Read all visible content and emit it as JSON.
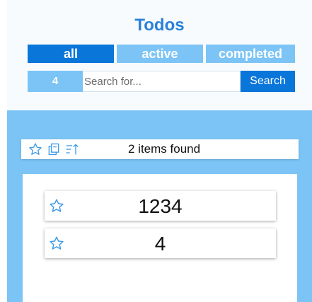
{
  "header": {
    "title": "Todos"
  },
  "tabs": [
    {
      "label": "all",
      "active": true
    },
    {
      "label": "active",
      "active": false
    },
    {
      "label": "completed",
      "active": false
    }
  ],
  "search": {
    "count": "4",
    "placeholder": "Search for...",
    "value": "",
    "button_label": "Search"
  },
  "toolbar": {
    "found_text": "2 items found",
    "icons": [
      "star-outline-icon",
      "copy-icon",
      "sort-icon"
    ]
  },
  "todos": [
    {
      "text": "1234",
      "starred": false
    },
    {
      "text": "4",
      "starred": false
    }
  ],
  "colors": {
    "accent": "#0a76d9",
    "accent_light": "#7cc4f5",
    "title": "#2980d9",
    "icon": "#3d9be9"
  }
}
